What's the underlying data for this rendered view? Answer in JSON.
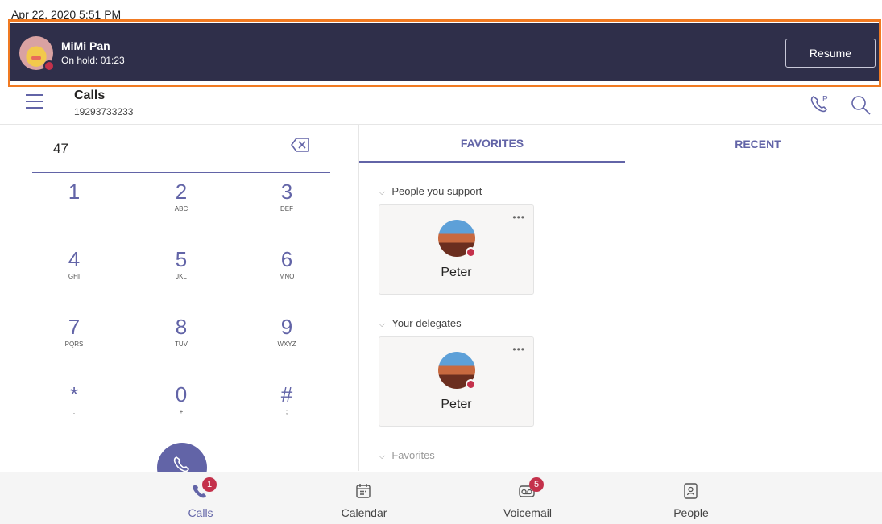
{
  "status_bar": {
    "datetime": "Apr 22, 2020  5:51 PM"
  },
  "hold_banner": {
    "name": "MiMi Pan",
    "status": "On hold: 01:23",
    "resume_label": "Resume"
  },
  "header": {
    "title": "Calls",
    "number": "19293733233"
  },
  "dialpad": {
    "input_value": "47",
    "keys": [
      {
        "digit": "1",
        "letters": ""
      },
      {
        "digit": "2",
        "letters": "ABC"
      },
      {
        "digit": "3",
        "letters": "DEF"
      },
      {
        "digit": "4",
        "letters": "GHI"
      },
      {
        "digit": "5",
        "letters": "JKL"
      },
      {
        "digit": "6",
        "letters": "MNO"
      },
      {
        "digit": "7",
        "letters": "PQRS"
      },
      {
        "digit": "8",
        "letters": "TUV"
      },
      {
        "digit": "9",
        "letters": "WXYZ"
      },
      {
        "digit": "*",
        "letters": "."
      },
      {
        "digit": "0",
        "letters": "+"
      },
      {
        "digit": "#",
        "letters": ";"
      }
    ]
  },
  "tabs": {
    "favorites": "FAVORITES",
    "recent": "RECENT"
  },
  "sections": [
    {
      "title": "People you support",
      "contact": "Peter"
    },
    {
      "title": "Your delegates",
      "contact": "Peter"
    },
    {
      "title": "Favorites"
    }
  ],
  "bottom_nav": [
    {
      "label": "Calls",
      "badge": "1"
    },
    {
      "label": "Calendar",
      "badge": ""
    },
    {
      "label": "Voicemail",
      "badge": "5"
    },
    {
      "label": "People",
      "badge": ""
    }
  ],
  "colors": {
    "accent": "#6264a7",
    "banner": "#2f2f4a",
    "highlight": "#f07a22",
    "busy": "#c4314b"
  }
}
